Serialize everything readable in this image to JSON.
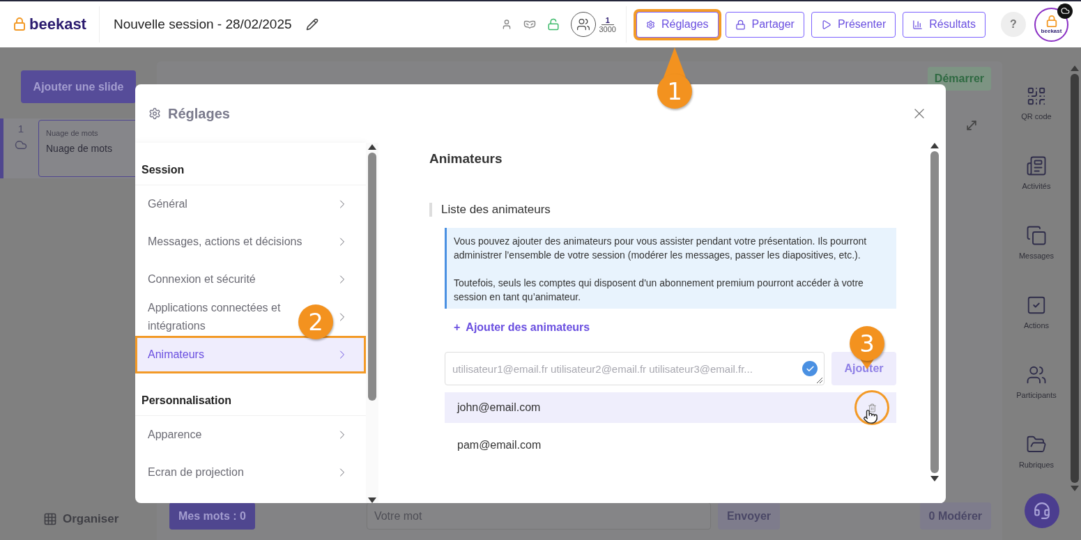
{
  "header": {
    "logo": "beekast",
    "title": "Nouvelle session - 28/02/2025",
    "participants": {
      "current": "1",
      "max": "3000"
    },
    "buttons": [
      {
        "label": "Réglages",
        "kind": "settings",
        "highlighted": true
      },
      {
        "label": "Partager",
        "kind": "share",
        "highlighted": false
      },
      {
        "label": "Présenter",
        "kind": "present",
        "highlighted": false
      },
      {
        "label": "Résultats",
        "kind": "results",
        "highlighted": false
      }
    ],
    "help": "?",
    "avatar": "beekast"
  },
  "sidebar": {
    "add_slide": "Ajouter une slide",
    "slides": [
      {
        "number": "1",
        "type": "Nuage de mots",
        "title": "Nuage de mots",
        "selected": true
      }
    ],
    "organise": "Organiser"
  },
  "stage": {
    "start": "Démarrer",
    "my_words": "Mes mots : 0",
    "word_input": {
      "placeholder": "Votre mot"
    },
    "send": "Envoyer",
    "moderate": "0 Modérer"
  },
  "tools": [
    {
      "label": "QR code",
      "kind": "qr"
    },
    {
      "label": "Activités",
      "kind": "activities"
    },
    {
      "label": "Messages",
      "kind": "messages"
    },
    {
      "label": "Actions",
      "kind": "actions"
    },
    {
      "label": "Participants",
      "kind": "participants"
    },
    {
      "label": "Rubriques",
      "kind": "folders"
    }
  ],
  "modal": {
    "title": "Réglages",
    "nav": [
      {
        "title": "Session",
        "items": [
          {
            "label": "Général",
            "selected": false,
            "highlighted": false
          },
          {
            "label": "Messages, actions et décisions",
            "selected": false,
            "highlighted": false
          },
          {
            "label": "Connexion et sécurité",
            "selected": false,
            "highlighted": false
          },
          {
            "label": "Applications connectées et intégrations",
            "selected": false,
            "highlighted": false
          },
          {
            "label": "Animateurs",
            "selected": true,
            "highlighted": true
          }
        ]
      },
      {
        "title": "Personnalisation",
        "items": [
          {
            "label": "Apparence",
            "selected": false,
            "highlighted": false
          },
          {
            "label": "Ecran de projection",
            "selected": false,
            "highlighted": false
          }
        ]
      }
    ],
    "heading": "Animateurs",
    "subheading": "Liste des animateurs",
    "info": [
      "Vous pouvez ajouter des animateurs pour vous assister pendant votre présentation. Ils pourront administrer l’ensemble de votre session (modérer les messages, passer les diapositives, etc.).",
      "Toutefois, seuls les comptes qui disposent d'un abonnement premium pourront accéder à votre session en tant qu’animateur."
    ],
    "add_link": {
      "plus": "+",
      "label": "Ajouter des animateurs"
    },
    "email_input": {
      "placeholder": "utilisateur1@email.fr utilisateur2@email.fr utilisateur3@email.fr..."
    },
    "add_button": {
      "label": "Ajouter",
      "disabled": true
    },
    "animators": [
      {
        "email": "john@email.com",
        "hovered": true
      },
      {
        "email": "pam@email.com",
        "hovered": false
      }
    ]
  },
  "callouts": [
    {
      "number": "1"
    },
    {
      "number": "2"
    },
    {
      "number": "3"
    }
  ]
}
